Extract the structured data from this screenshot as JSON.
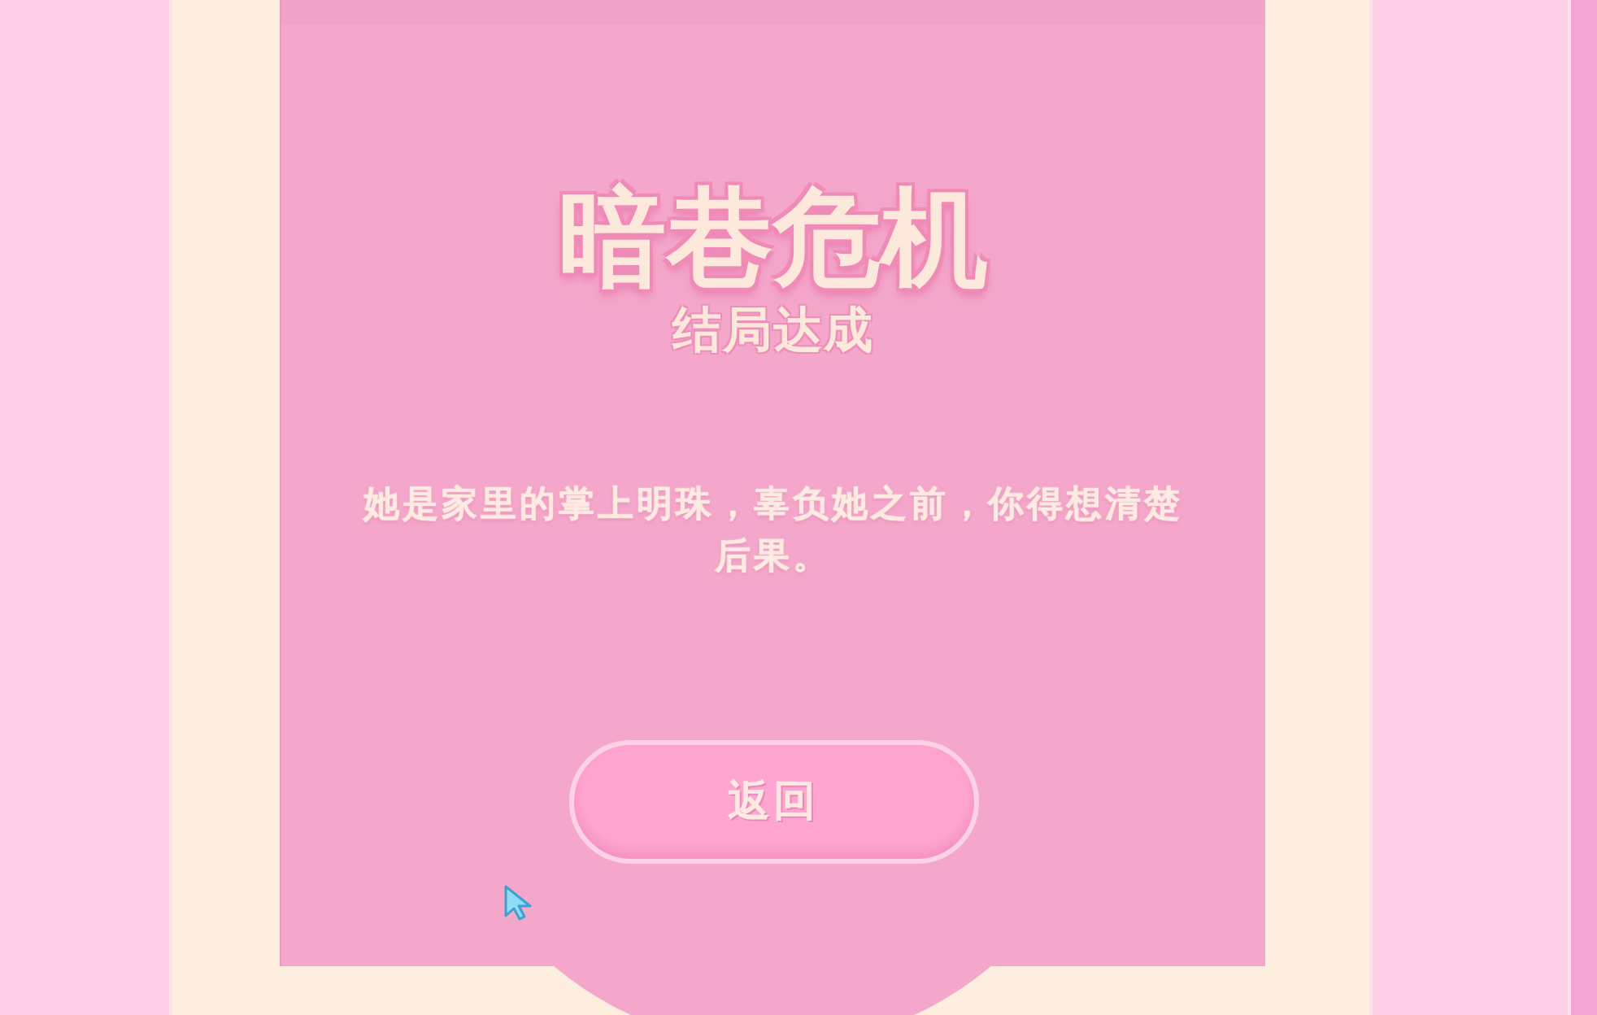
{
  "screen": {
    "title": "暗巷危机",
    "subtitle": "结局达成",
    "message": "她是家里的掌上明珠，辜负她之前，你得想清楚后果。",
    "buttons": [
      {
        "label": "返回"
      }
    ]
  }
}
